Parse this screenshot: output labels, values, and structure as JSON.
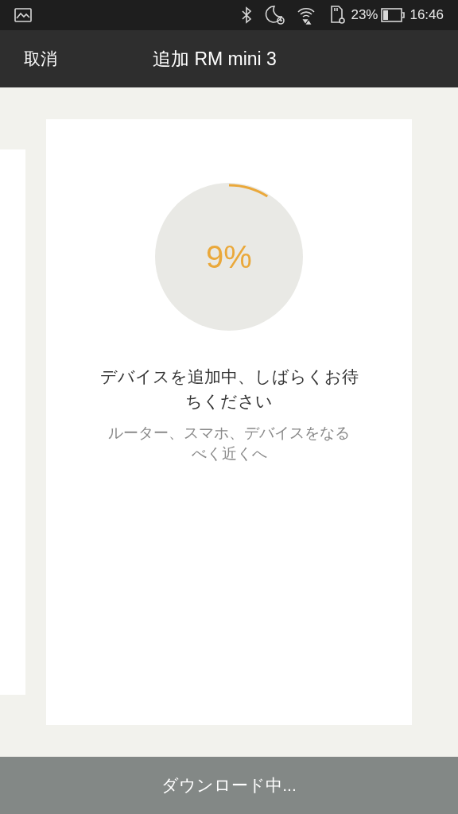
{
  "status_bar": {
    "battery_text": "23%",
    "time": "16:46"
  },
  "header": {
    "cancel": "取消",
    "title": "追加 RM mini 3"
  },
  "progress": {
    "label": "9%"
  },
  "message": "デバイスを追加中、しばらくお待ちください",
  "hint": "ルーター、スマホ、デバイスをなるべく近くへ",
  "bottom_bar": {
    "label": "ダウンロード中..."
  }
}
